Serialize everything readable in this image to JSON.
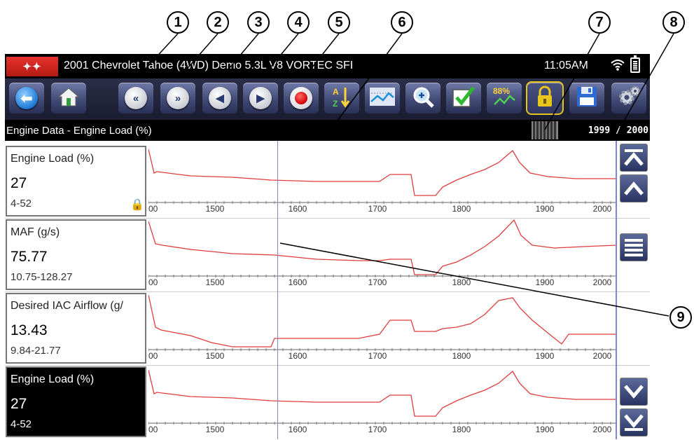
{
  "header": {
    "app_logo": "Verus-style logo",
    "vehicle": "2001 Chevrolet Tahoe (4WD) Demo 5.3L V8 VORTEC SFI",
    "time": "11:05AM",
    "wifi_icon": "wifi-icon",
    "battery_icon": "battery-icon"
  },
  "toolbar": {
    "buttons": [
      {
        "name": "back-button",
        "icon": "back-arrow-icon"
      },
      {
        "name": "home-button",
        "icon": "home-icon"
      },
      {
        "name": "skip-back-button",
        "icon": "double-left-icon"
      },
      {
        "name": "skip-forward-button",
        "icon": "double-right-icon"
      },
      {
        "name": "step-back-button",
        "icon": "left-icon"
      },
      {
        "name": "step-forward-button",
        "icon": "right-icon"
      },
      {
        "name": "record-button",
        "icon": "record-icon"
      },
      {
        "name": "sort-button",
        "icon": "sort-az-icon"
      },
      {
        "name": "graph-view-button",
        "icon": "graph-icon"
      },
      {
        "name": "zoom-button",
        "icon": "zoom-icon"
      },
      {
        "name": "select-button",
        "icon": "checkmark-icon"
      },
      {
        "name": "percent-button",
        "icon": "percent-graph-icon",
        "label": "88%"
      },
      {
        "name": "lock-button",
        "icon": "lock-icon"
      },
      {
        "name": "save-button",
        "icon": "floppy-disk-icon"
      },
      {
        "name": "settings-button",
        "icon": "gear-icon"
      }
    ]
  },
  "subbar": {
    "title": "Engine Data - Engine Load (%)",
    "counter": "1999 / 2000"
  },
  "callouts": [
    "1",
    "2",
    "3",
    "4",
    "5",
    "6",
    "7",
    "8",
    "9"
  ],
  "graph_axis_ticks": [
    "00",
    "1500",
    "1600",
    "1700",
    "1800",
    "1900",
    "2000"
  ],
  "trace_color": "#e03c3c",
  "rows": [
    {
      "name": "Engine Load (%)",
      "value": "27",
      "range": "4-52",
      "locked": true,
      "selected": false
    },
    {
      "name": "MAF (g/s)",
      "value": "75.77",
      "range": "10.75-128.27",
      "locked": false,
      "selected": false
    },
    {
      "name": "Desired IAC Airflow (g/",
      "value": "13.43",
      "range": "9.84-21.77",
      "locked": false,
      "selected": false
    },
    {
      "name": "Engine Load (%)",
      "value": "27",
      "range": "4-52",
      "locked": false,
      "selected": true
    }
  ],
  "lock_glyph": "🔒"
}
